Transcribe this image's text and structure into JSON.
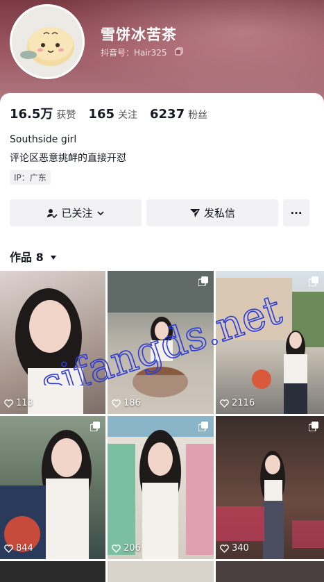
{
  "profile": {
    "nickname": "雪饼冰苦茶",
    "douyin_id": "抖音号：Hair325",
    "bio_line1": "Southside girl",
    "bio_line2": "评论区恶意挑衅的直接开怼",
    "ip": "IP：广东"
  },
  "stats": [
    {
      "num": "16.5万",
      "label": "获赞"
    },
    {
      "num": "165",
      "label": "关注"
    },
    {
      "num": "6237",
      "label": "粉丝"
    }
  ],
  "actions": {
    "following_label": "已关注",
    "message_label": "发私信",
    "more_label": "···"
  },
  "works": {
    "label": "作品 8"
  },
  "posts": [
    {
      "likes": "113"
    },
    {
      "likes": "186"
    },
    {
      "likes": "2116"
    },
    {
      "likes": "844"
    },
    {
      "likes": "206"
    },
    {
      "likes": "340"
    }
  ],
  "watermark": "sifangds.net",
  "icons": [
    "copy-icon",
    "user-check-icon",
    "chevron-down-icon",
    "paper-plane-icon",
    "more-icon",
    "caret-down-icon",
    "heart-icon",
    "multi-image-icon"
  ]
}
